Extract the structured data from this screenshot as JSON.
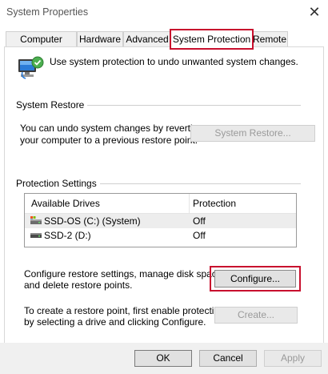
{
  "window": {
    "title": "System Properties",
    "close_glyph": "✕",
    "accent_highlight": "#c8102e"
  },
  "tabs": [
    {
      "label": "Computer Name",
      "active": false
    },
    {
      "label": "Hardware",
      "active": false
    },
    {
      "label": "Advanced",
      "active": false
    },
    {
      "label": "System Protection",
      "active": true
    },
    {
      "label": "Remote",
      "active": false
    }
  ],
  "intro": {
    "text": "Use system protection to undo unwanted system changes.",
    "icon": "system-protection-computer-icon"
  },
  "system_restore": {
    "heading": "System Restore",
    "description_line1": "You can undo system changes by reverting",
    "description_line2": "your computer to a previous restore point.",
    "button_label": "System Restore...",
    "button_enabled": false
  },
  "protection_settings": {
    "heading": "Protection Settings",
    "columns": [
      "Available Drives",
      "Protection"
    ],
    "drives": [
      {
        "name": "SSD-OS (C:) (System)",
        "protection": "Off",
        "icon": "system-drive-icon",
        "selected": true
      },
      {
        "name": "SSD-2 (D:)",
        "protection": "Off",
        "icon": "drive-icon",
        "selected": false
      }
    ],
    "configure_text_line1": "Configure restore settings, manage disk space,",
    "configure_text_line2": "and delete restore points.",
    "configure_button": "Configure...",
    "create_text_line1": "To create a restore point, first enable protection",
    "create_text_line2": "by selecting a drive and clicking Configure.",
    "create_button": "Create...",
    "create_button_enabled": false
  },
  "footer": {
    "ok": "OK",
    "cancel": "Cancel",
    "apply": "Apply",
    "apply_enabled": false
  }
}
